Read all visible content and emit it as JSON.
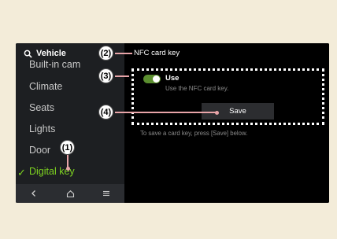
{
  "sidebar": {
    "title": "Vehicle",
    "items": [
      {
        "label": "Built-in cam"
      },
      {
        "label": "Climate"
      },
      {
        "label": "Seats"
      },
      {
        "label": "Lights"
      },
      {
        "label": "Door"
      },
      {
        "label": "Digital key"
      }
    ],
    "active_item": "Digital key",
    "bottom_nav": {
      "back_icon": "chevron-left-icon",
      "home_icon": "home-icon",
      "menu_icon": "menu-icon"
    }
  },
  "content": {
    "title": "NFC card key",
    "toggle": {
      "label": "Use",
      "description": "Use the NFC card key.",
      "state": "on"
    },
    "save_button": "Save",
    "hint": "To save a card key, press [Save] below."
  },
  "callouts": [
    "(1)",
    "(2)",
    "(3)",
    "(4)"
  ],
  "colors": {
    "accent_green": "#7ed321",
    "toggle_green": "#5b8e2f",
    "background": "#f3ecd9",
    "leader_line": "#e8a4a8"
  }
}
